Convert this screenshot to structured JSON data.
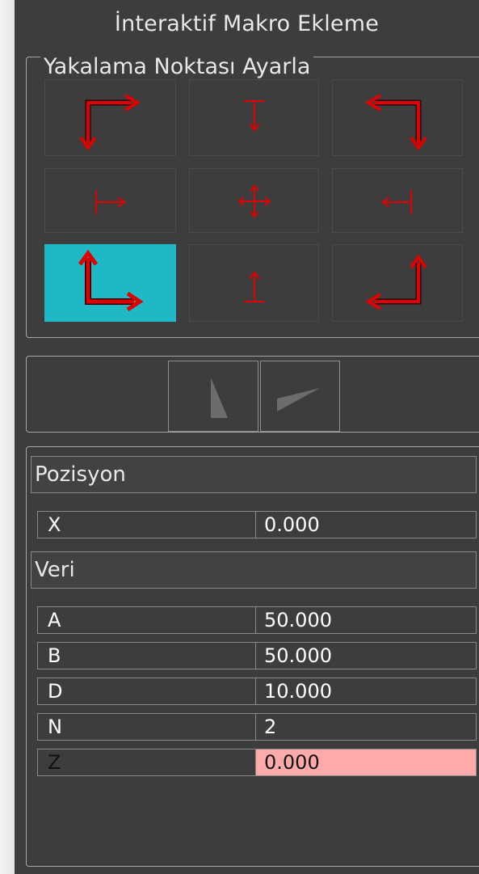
{
  "title": "İnteraktif Makro Ekleme",
  "snap_group": {
    "label": "Yakalama Noktası Ayarla",
    "selected": "bottom-left",
    "points": [
      "top-left",
      "top-center",
      "top-right",
      "middle-left",
      "center",
      "middle-right",
      "bottom-left",
      "bottom-center",
      "bottom-right"
    ]
  },
  "orientation_tools": [
    "vertical-triangle",
    "horizontal-triangle"
  ],
  "properties": {
    "position_header": "Pozisyon",
    "position_rows": [
      {
        "key": "X",
        "value": "0.000"
      }
    ],
    "data_header": "Veri",
    "data_rows": [
      {
        "key": "A",
        "value": "50.000"
      },
      {
        "key": "B",
        "value": "50.000"
      },
      {
        "key": "D",
        "value": "10.000"
      },
      {
        "key": "N",
        "value": "2"
      },
      {
        "key": "Z",
        "value": "0.000"
      }
    ]
  },
  "colors": {
    "arrow": "#e00000",
    "selected": "#1eb9c4",
    "error_cell": "#ffaaaa",
    "panel": "#3d3d3d"
  }
}
